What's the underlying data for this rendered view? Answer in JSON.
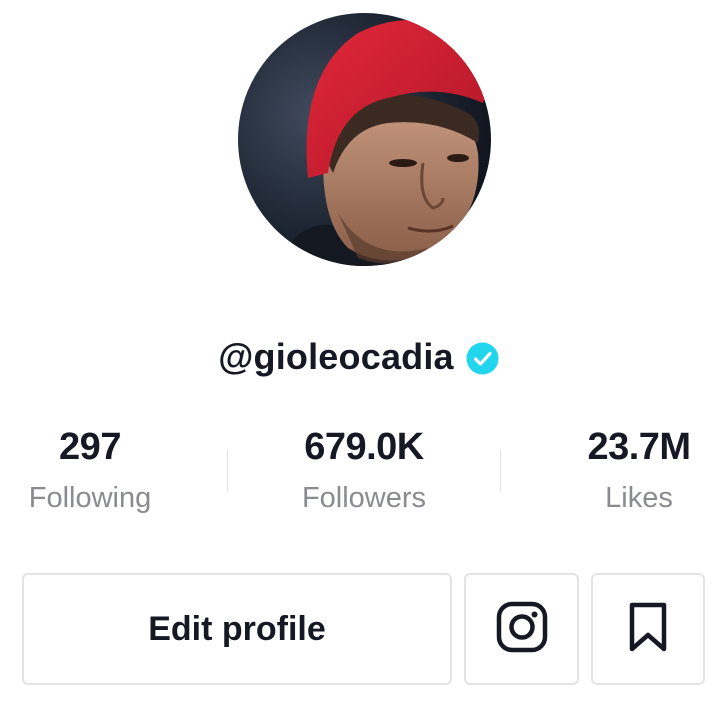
{
  "profile": {
    "handle": "@gioleocadia",
    "verified_icon": "verified-badge-icon",
    "verified_color": "#20d5ec"
  },
  "stats": [
    {
      "value": "297",
      "label": "Following"
    },
    {
      "value": "679.0K",
      "label": "Followers"
    },
    {
      "value": "23.7M",
      "label": "Likes"
    }
  ],
  "actions": {
    "edit_profile_label": "Edit profile",
    "instagram_icon": "instagram-icon",
    "bookmark_icon": "bookmark-icon"
  },
  "colors": {
    "text_primary": "#161823",
    "text_secondary": "#8a8b91",
    "border": "#e3e3e4",
    "accent": "#20d5ec"
  }
}
